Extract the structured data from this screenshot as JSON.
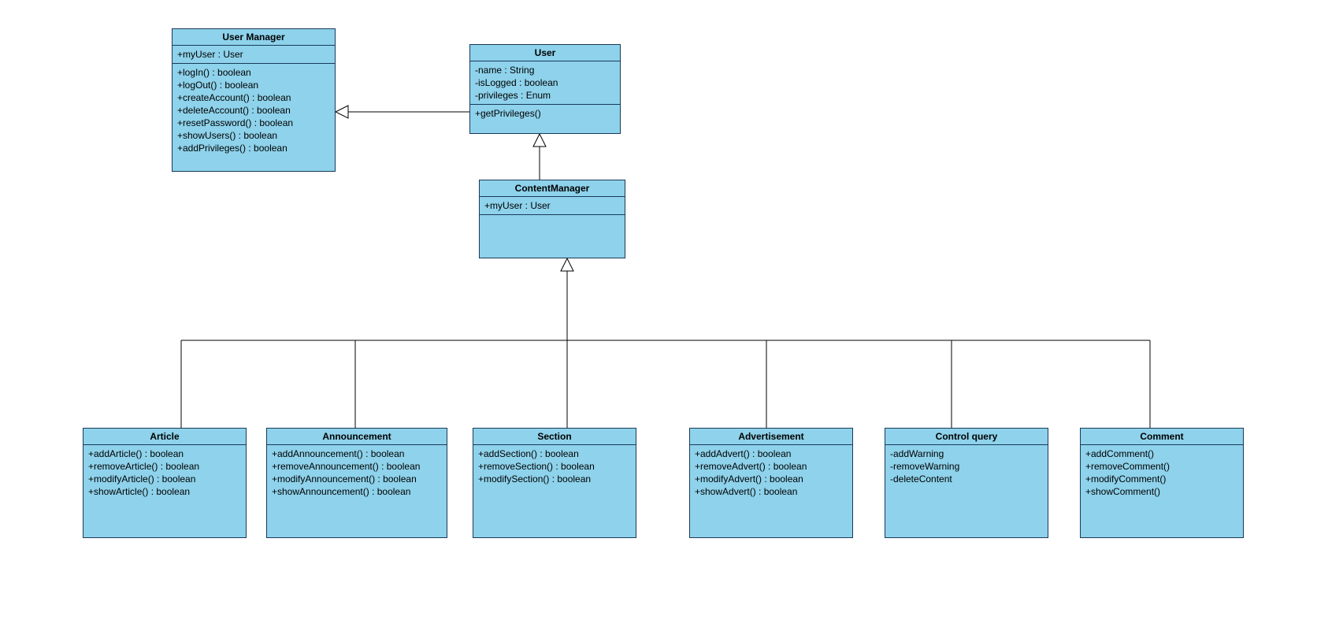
{
  "classes": {
    "userManager": {
      "name": "User Manager",
      "attributes": [
        "+myUser : User"
      ],
      "methods": [
        "+logIn() : boolean",
        "+logOut() : boolean",
        "+createAccount() : boolean",
        "+deleteAccount() : boolean",
        "+resetPassword() : boolean",
        "+showUsers() : boolean",
        "+addPrivileges() : boolean"
      ]
    },
    "user": {
      "name": "User",
      "attributes": [
        "-name : String",
        "-isLogged : boolean",
        "-privileges : Enum"
      ],
      "methods": [
        "+getPrivileges()"
      ]
    },
    "contentManager": {
      "name": "ContentManager",
      "attributes": [
        "+myUser : User"
      ],
      "methods": []
    },
    "article": {
      "name": "Article",
      "attributes": [],
      "methods": [
        "+addArticle() : boolean",
        "+removeArticle() : boolean",
        "+modifyArticle() : boolean",
        "+showArticle() : boolean"
      ]
    },
    "announcement": {
      "name": "Announcement",
      "attributes": [],
      "methods": [
        "+addAnnouncement() : boolean",
        "+removeAnnouncement() : boolean",
        "+modifyAnnouncement() : boolean",
        "+showAnnouncement() : boolean"
      ]
    },
    "section": {
      "name": "Section",
      "attributes": [],
      "methods": [
        "+addSection() : boolean",
        "+removeSection() : boolean",
        "+modifySection() : boolean"
      ]
    },
    "advertisement": {
      "name": "Advertisement",
      "attributes": [],
      "methods": [
        "+addAdvert() : boolean",
        "+removeAdvert() : boolean",
        "+modifyAdvert() : boolean",
        "+showAdvert() : boolean"
      ]
    },
    "controlQuery": {
      "name": "Control query",
      "attributes": [],
      "methods": [
        "-addWarning",
        "-removeWarning",
        "-deleteContent"
      ]
    },
    "comment": {
      "name": "Comment",
      "attributes": [],
      "methods": [
        "+addComment()",
        "+removeComment()",
        "+modifyComment()",
        "+showComment()"
      ]
    }
  }
}
